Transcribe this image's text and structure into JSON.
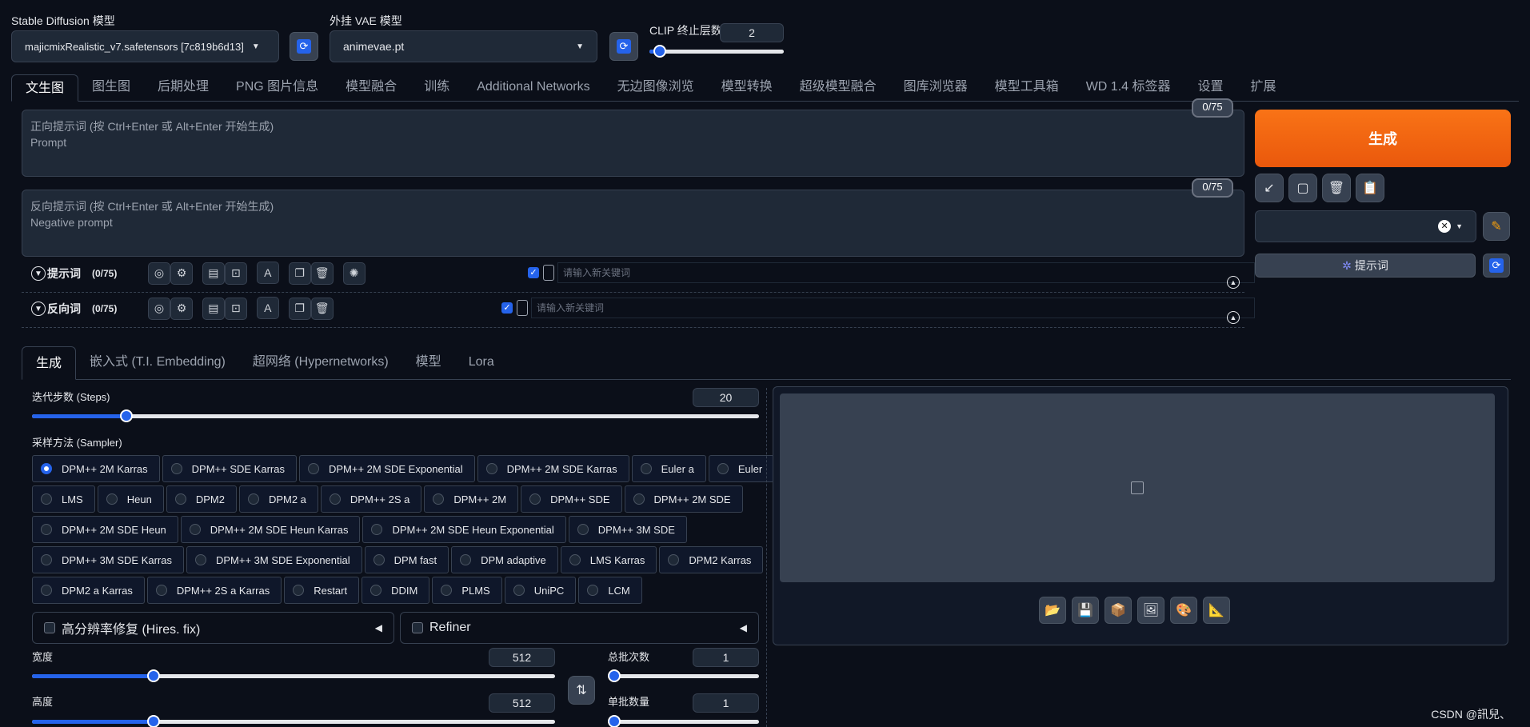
{
  "header": {
    "sd_model_label": "Stable Diffusion 模型",
    "sd_model_value": "majicmixRealistic_v7.safetensors [7c819b6d13]",
    "vae_label": "外挂 VAE 模型",
    "vae_value": "animevae.pt",
    "clip_label": "CLIP 终止层数",
    "clip_value": "2",
    "clip_level": 0.08
  },
  "tabs": [
    "文生图",
    "图生图",
    "后期处理",
    "PNG 图片信息",
    "模型融合",
    "训练",
    "Additional Networks",
    "无边图像浏览",
    "模型转换",
    "超级模型融合",
    "图库浏览器",
    "模型工具箱",
    "WD 1.4 标签器",
    "设置",
    "扩展"
  ],
  "prompt": {
    "placeholder_line1": "正向提示词 (按 Ctrl+Enter 或 Alt+Enter 开始生成)",
    "placeholder_line2": "Prompt",
    "counter": "0/75"
  },
  "negative": {
    "placeholder_line1": "反向提示词 (按 Ctrl+Enter 或 Alt+Enter 开始生成)",
    "placeholder_line2": "Negative prompt",
    "counter": "0/75"
  },
  "helper": {
    "positive_title": "提示词",
    "positive_count": "(0/75)",
    "negative_title": "反向词",
    "negative_count": "(0/75)",
    "keyword_placeholder": "请输入新关键词"
  },
  "side": {
    "generate_label": "生成",
    "prompt_button_label": "提示词"
  },
  "subtabs": [
    "生成",
    "嵌入式 (T.I. Embedding)",
    "超网络 (Hypernetworks)",
    "模型",
    "Lora"
  ],
  "steps": {
    "label": "迭代步数 (Steps)",
    "value": "20",
    "level": 0.13
  },
  "sampler": {
    "label": "采样方法 (Sampler)",
    "selected": "DPM++ 2M Karras",
    "rows": [
      [
        "DPM++ 2M Karras",
        "DPM++ SDE Karras",
        "DPM++ 2M SDE Exponential",
        "DPM++ 2M SDE Karras",
        "Euler a",
        "Euler"
      ],
      [
        "LMS",
        "Heun",
        "DPM2",
        "DPM2 a",
        "DPM++ 2S a",
        "DPM++ 2M",
        "DPM++ SDE",
        "DPM++ 2M SDE"
      ],
      [
        "DPM++ 2M SDE Heun",
        "DPM++ 2M SDE Heun Karras",
        "DPM++ 2M SDE Heun Exponential",
        "DPM++ 3M SDE"
      ],
      [
        "DPM++ 3M SDE Karras",
        "DPM++ 3M SDE Exponential",
        "DPM fast",
        "DPM adaptive",
        "LMS Karras",
        "DPM2 Karras"
      ],
      [
        "DPM2 a Karras",
        "DPM++ 2S a Karras",
        "Restart",
        "DDIM",
        "PLMS",
        "UniPC",
        "LCM"
      ]
    ]
  },
  "hires_label": "高分辨率修复 (Hires. fix)",
  "refiner_label": "Refiner",
  "width": {
    "label": "宽度",
    "value": "512"
  },
  "height": {
    "label": "高度",
    "value": "512"
  },
  "batch_count": {
    "label": "总批次数",
    "value": "1"
  },
  "batch_size": {
    "label": "单批数量",
    "value": "1"
  },
  "watermark": "CSDN @訊兒、"
}
